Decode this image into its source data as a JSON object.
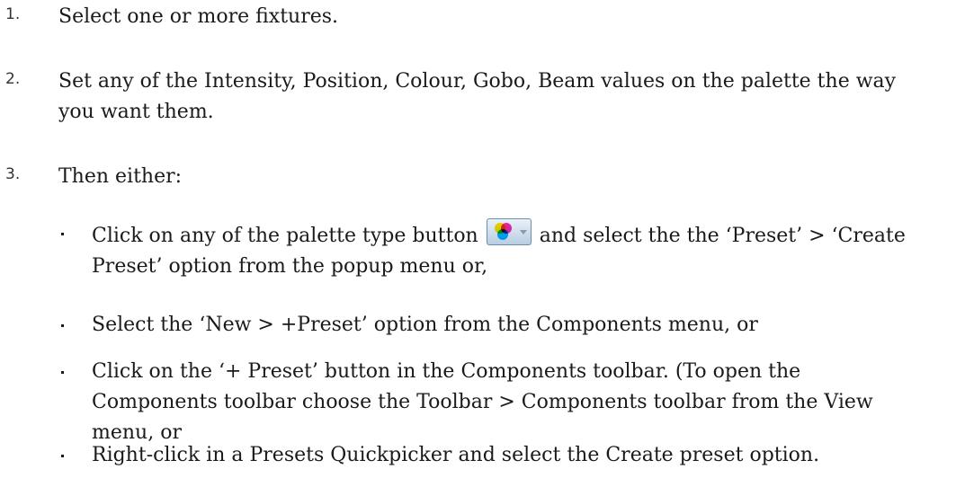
{
  "steps": [
    {
      "number": "1.",
      "text": "Select one or more fixtures."
    },
    {
      "number": "2.",
      "text": "Set any of the Intensity, Position, Colour, Gobo, Beam values on the palette the way you want them."
    },
    {
      "number": "3.",
      "text": "Then either:"
    }
  ],
  "options": [
    {
      "before": "Click on any of the palette type button",
      "icon": "colour-palette-button-icon",
      "after": "and select the the ‘Preset’ > ‘Create Preset’ option from the popup menu or,"
    },
    {
      "text": "Select the ‘New > +Preset’ option from the Components menu, or"
    },
    {
      "text": "Click on the ‘+ Preset’ button in the Components toolbar. (To open the Components toolbar choose the Toolbar > Components toolbar from the View menu, or"
    },
    {
      "text": "Right-click in a Presets Quickpicker and select the Create preset option."
    }
  ],
  "colors": {
    "text": "#1a1a1a",
    "background": "#ffffff",
    "icon_yellow": "#ffe000",
    "icon_magenta": "#ff2aa6",
    "icon_cyan": "#00b4ff"
  }
}
